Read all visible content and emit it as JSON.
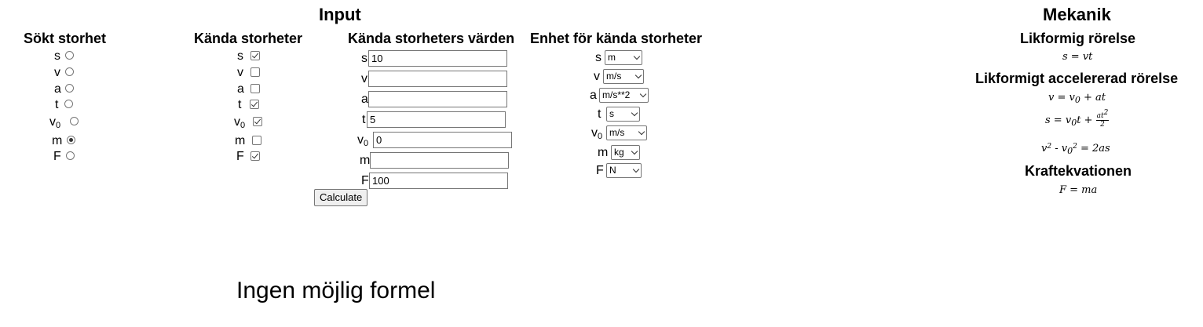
{
  "input_title": "Input",
  "mechanics_title": "Mekanik",
  "col_sought": "Sökt storhet",
  "col_known": "Kända storheter",
  "col_values": "Kända storheters värden",
  "col_units": "Enhet för kända storheter",
  "variables": {
    "s": {
      "label": "s"
    },
    "v": {
      "label": "v"
    },
    "a": {
      "label": "a"
    },
    "t": {
      "label": "t"
    },
    "v0": {
      "label": "v",
      "sub": "0"
    },
    "m": {
      "label": "m"
    },
    "F": {
      "label": "F"
    }
  },
  "sought_selected": "m",
  "known_checked": {
    "s": true,
    "v": false,
    "a": false,
    "t": true,
    "v0": true,
    "m": false,
    "F": true
  },
  "values": {
    "s": "10",
    "v": "",
    "a": "",
    "t": "5",
    "v0": "0",
    "m": "",
    "F": "100"
  },
  "units": {
    "s": "m",
    "v": "m/s",
    "a": "m/s**2",
    "t": "s",
    "v0": "m/s",
    "m": "kg",
    "F": "N"
  },
  "calculate_label": "Calculate",
  "result_text": "Ingen möjlig formel",
  "sections": {
    "uniform": "Likformig rörelse",
    "accelerated": "Likformigt accelererad rörelse",
    "force": "Kraftekvationen"
  },
  "formulas": {
    "f1": "s = vt",
    "f2": "v = v₀ + at",
    "f3": "s = v₀t + at²/2",
    "f4": "v² - v₀² = 2as",
    "f5": "F = ma"
  }
}
